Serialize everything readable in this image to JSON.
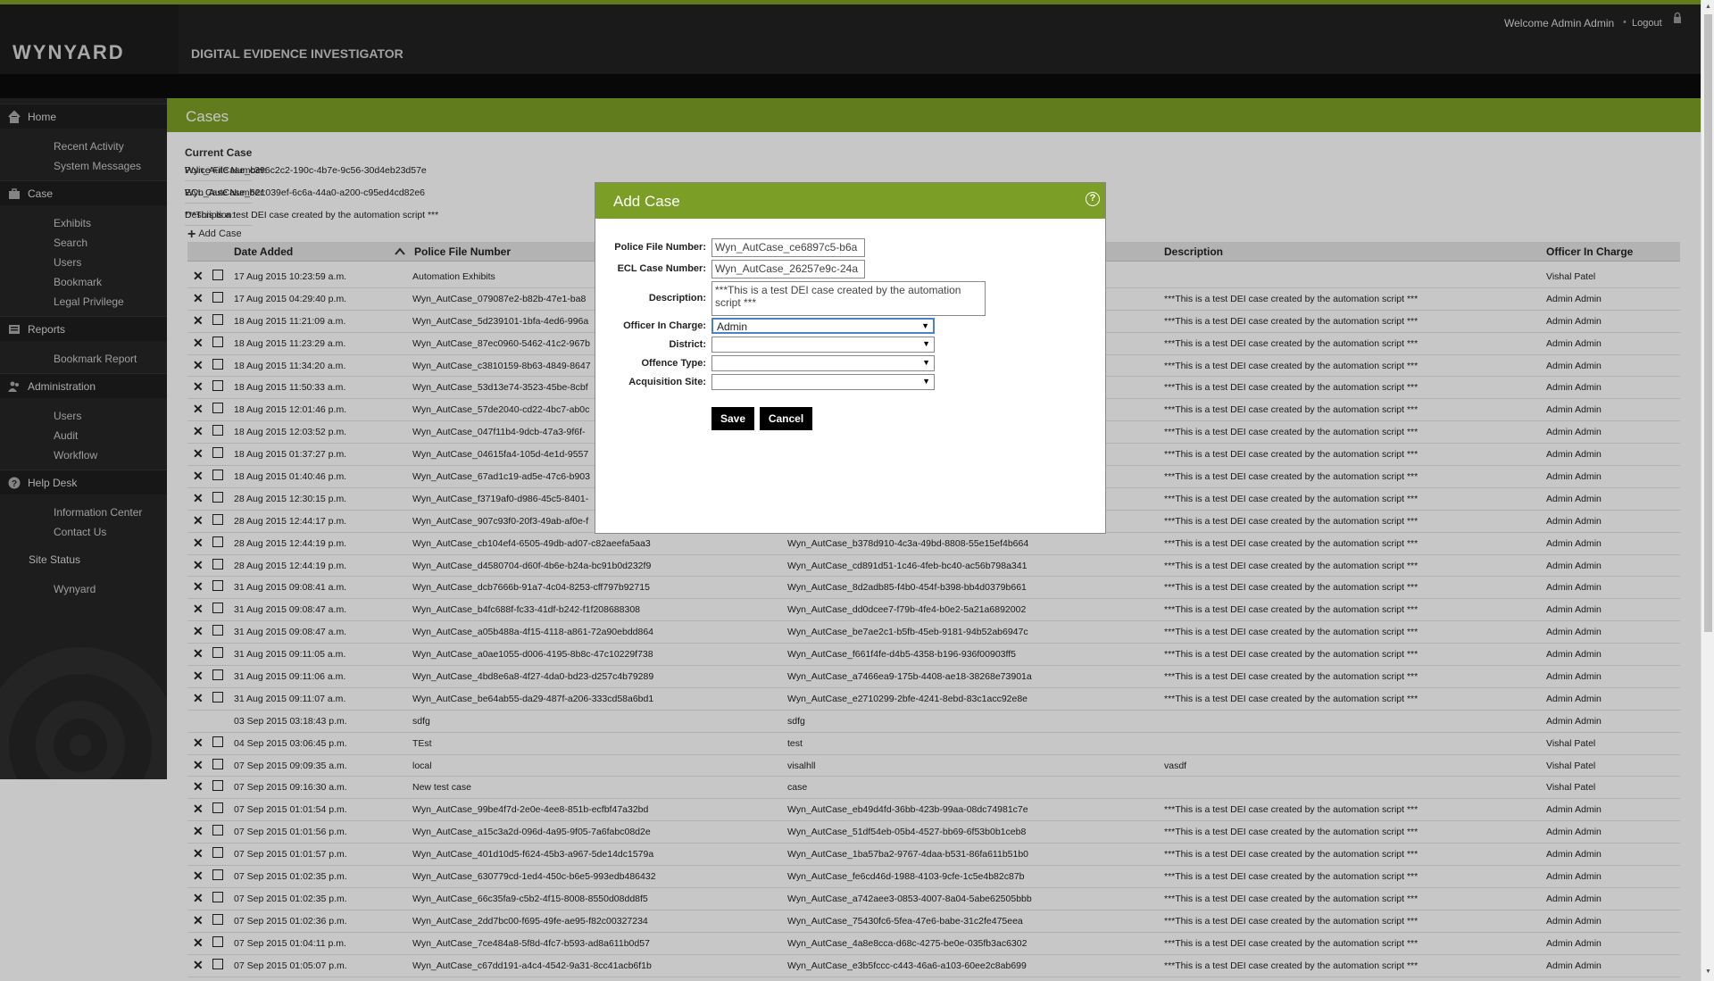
{
  "header": {
    "logo": "WYNYARD",
    "app_title": "DIGITAL EVIDENCE INVESTIGATOR",
    "welcome": "Welcome Admin Admin",
    "logout": "Logout"
  },
  "sidebar": {
    "home": "Home",
    "home_items": [
      "Recent Activity",
      "System Messages"
    ],
    "case": "Case",
    "case_items": [
      "Exhibits",
      "Search",
      "Users",
      "Bookmark",
      "Legal Privilege"
    ],
    "reports": "Reports",
    "reports_items": [
      "Bookmark Report"
    ],
    "administration": "Administration",
    "admin_items": [
      "Users",
      "Audit",
      "Workflow"
    ],
    "helpdesk": "Help Desk",
    "help_items": [
      "Information Center",
      "Contact Us"
    ],
    "site_status": "Site Status",
    "site": "Wynyard"
  },
  "page": {
    "title": "Cases",
    "current_case": {
      "heading": "Current Case",
      "police_label": "Police File Number:",
      "police_value": "Wyn_AutCase_c396c2c2-190c-4b7e-9c56-30d4eb23d57e",
      "ecl_label": "ECL Case Number:",
      "ecl_value": "Wyn_AutCase_621039ef-6c6a-44a0-a200-c95ed4cd82e6",
      "desc_label": "Description:",
      "desc_value": "***This is a test DEI case created by the automation script ***"
    },
    "add_case": "Add Case"
  },
  "table": {
    "headers": {
      "date": "Date Added",
      "police": "Police File Number",
      "desc": "Description",
      "officer": "Officer In Charge"
    },
    "rows": [
      {
        "date": "17 Aug 2015 10:23:59 a.m.",
        "pf": "Automation Exhibits",
        "ecl": "",
        "desc": "",
        "off": "Vishal Patel"
      },
      {
        "date": "17 Aug 2015 04:29:40 p.m.",
        "pf": "Wyn_AutCase_079087e2-b82b-47e1-ba8",
        "ecl": "",
        "desc": "***This is a test DEI case created by the automation script ***",
        "off": "Admin Admin"
      },
      {
        "date": "18 Aug 2015 11:21:09 a.m.",
        "pf": "Wyn_AutCase_5d239101-1bfa-4ed6-996a",
        "ecl": "",
        "desc": "***This is a test DEI case created by the automation script ***",
        "off": "Admin Admin"
      },
      {
        "date": "18 Aug 2015 11:23:29 a.m.",
        "pf": "Wyn_AutCase_87ec0960-5462-41c2-967b",
        "ecl": "",
        "desc": "***This is a test DEI case created by the automation script ***",
        "off": "Admin Admin"
      },
      {
        "date": "18 Aug 2015 11:34:20 a.m.",
        "pf": "Wyn_AutCase_c3810159-8b63-4849-8647",
        "ecl": "",
        "desc": "***This is a test DEI case created by the automation script ***",
        "off": "Admin Admin"
      },
      {
        "date": "18 Aug 2015 11:50:33 a.m.",
        "pf": "Wyn_AutCase_53d13e74-3523-45be-8cbf",
        "ecl": "",
        "desc": "***This is a test DEI case created by the automation script ***",
        "off": "Admin Admin"
      },
      {
        "date": "18 Aug 2015 12:01:46 p.m.",
        "pf": "Wyn_AutCase_57de2040-cd22-4bc7-ab0c",
        "ecl": "",
        "desc": "***This is a test DEI case created by the automation script ***",
        "off": "Admin Admin"
      },
      {
        "date": "18 Aug 2015 12:03:52 p.m.",
        "pf": "Wyn_AutCase_047f11b4-9dcb-47a3-9f6f-",
        "ecl": "",
        "desc": "***This is a test DEI case created by the automation script ***",
        "off": "Admin Admin"
      },
      {
        "date": "18 Aug 2015 01:37:27 p.m.",
        "pf": "Wyn_AutCase_04615fa4-105d-4e1d-9557",
        "ecl": "",
        "desc": "***This is a test DEI case created by the automation script ***",
        "off": "Admin Admin"
      },
      {
        "date": "18 Aug 2015 01:40:46 p.m.",
        "pf": "Wyn_AutCase_67ad1c19-ad5e-47c6-b903",
        "ecl": "",
        "desc": "***This is a test DEI case created by the automation script ***",
        "off": "Admin Admin"
      },
      {
        "date": "28 Aug 2015 12:30:15 p.m.",
        "pf": "Wyn_AutCase_f3719af0-d986-45c5-8401-",
        "ecl": "",
        "desc": "***This is a test DEI case created by the automation script ***",
        "off": "Admin Admin"
      },
      {
        "date": "28 Aug 2015 12:44:17 p.m.",
        "pf": "Wyn_AutCase_907c93f0-20f3-49ab-af0e-f",
        "ecl": "",
        "desc": "***This is a test DEI case created by the automation script ***",
        "off": "Admin Admin"
      },
      {
        "date": "28 Aug 2015 12:44:19 p.m.",
        "pf": "Wyn_AutCase_cb104ef4-6505-49db-ad07-c82aeefa5aa3",
        "ecl": "Wyn_AutCase_b378d910-4c3a-49bd-8808-55e15ef4b664",
        "desc": "***This is a test DEI case created by the automation script ***",
        "off": "Admin Admin"
      },
      {
        "date": "28 Aug 2015 12:44:19 p.m.",
        "pf": "Wyn_AutCase_d4580704-d60f-4b6e-b24a-bc91b0d232f9",
        "ecl": "Wyn_AutCase_cd891d51-1c46-4feb-bc40-ac56b798a341",
        "desc": "***This is a test DEI case created by the automation script ***",
        "off": "Admin Admin"
      },
      {
        "date": "31 Aug 2015 09:08:41 a.m.",
        "pf": "Wyn_AutCase_dcb7666b-91a7-4c04-8253-cff797b92715",
        "ecl": "Wyn_AutCase_8d2adb85-f4b0-454f-b398-bb4d0379b661",
        "desc": "***This is a test DEI case created by the automation script ***",
        "off": "Admin Admin"
      },
      {
        "date": "31 Aug 2015 09:08:47 a.m.",
        "pf": "Wyn_AutCase_b4fc688f-fc33-41df-b242-f1f208688308",
        "ecl": "Wyn_AutCase_dd0dcee7-f79b-4fe4-b0e2-5a21a6892002",
        "desc": "***This is a test DEI case created by the automation script ***",
        "off": "Admin Admin"
      },
      {
        "date": "31 Aug 2015 09:08:47 a.m.",
        "pf": "Wyn_AutCase_a05b488a-4f15-4118-a861-72a90ebdd864",
        "ecl": "Wyn_AutCase_be7ae2c1-b5fb-45eb-9181-94b52ab6947c",
        "desc": "***This is a test DEI case created by the automation script ***",
        "off": "Admin Admin"
      },
      {
        "date": "31 Aug 2015 09:11:05 a.m.",
        "pf": "Wyn_AutCase_a0ae1055-d006-4195-8b8c-47c10229f738",
        "ecl": "Wyn_AutCase_f661f4fe-d4b5-4358-b196-936f00903ff5",
        "desc": "***This is a test DEI case created by the automation script ***",
        "off": "Admin Admin"
      },
      {
        "date": "31 Aug 2015 09:11:06 a.m.",
        "pf": "Wyn_AutCase_4bd8e6a8-4f27-4da0-bd23-d257c4b79289",
        "ecl": "Wyn_AutCase_a7466ea9-175b-4408-ae18-38268e73901a",
        "desc": "***This is a test DEI case created by the automation script ***",
        "off": "Admin Admin"
      },
      {
        "date": "31 Aug 2015 09:11:07 a.m.",
        "pf": "Wyn_AutCase_be64ab55-da29-487f-a206-333cd58a6bd1",
        "ecl": "Wyn_AutCase_e2710299-2bfe-4241-8ebd-83c1acc92e8e",
        "desc": "***This is a test DEI case created by the automation script ***",
        "off": "Admin Admin"
      },
      {
        "date": "03 Sep 2015 03:18:43 p.m.",
        "pf": "sdfg",
        "ecl": "sdfg",
        "desc": "",
        "off": "Admin Admin",
        "noicons": true
      },
      {
        "date": "04 Sep 2015 03:06:45 p.m.",
        "pf": "TEst",
        "ecl": "test",
        "desc": "",
        "off": "Vishal Patel"
      },
      {
        "date": "07 Sep 2015 09:09:35 a.m.",
        "pf": "local",
        "ecl": "visalhll",
        "desc": "vasdf",
        "off": "Vishal Patel"
      },
      {
        "date": "07 Sep 2015 09:16:30 a.m.",
        "pf": "New test case",
        "ecl": "case",
        "desc": "",
        "off": "Vishal Patel"
      },
      {
        "date": "07 Sep 2015 01:01:54 p.m.",
        "pf": "Wyn_AutCase_99be4f7d-2e0e-4ee8-851b-ecfbf47a32bd",
        "ecl": "Wyn_AutCase_eb49d4fd-36bb-423b-99aa-08dc74981c7e",
        "desc": "***This is a test DEI case created by the automation script ***",
        "off": "Admin Admin"
      },
      {
        "date": "07 Sep 2015 01:01:56 p.m.",
        "pf": "Wyn_AutCase_a15c3a2d-096d-4a95-9f05-7a6fabc08d2e",
        "ecl": "Wyn_AutCase_51df54eb-05b4-4527-bb69-6f53b0b1ceb8",
        "desc": "***This is a test DEI case created by the automation script ***",
        "off": "Admin Admin"
      },
      {
        "date": "07 Sep 2015 01:01:57 p.m.",
        "pf": "Wyn_AutCase_401d10d5-f624-45b3-a967-5de14dc1579a",
        "ecl": "Wyn_AutCase_1ba57ba2-9767-4daa-b531-86fa611b51b0",
        "desc": "***This is a test DEI case created by the automation script ***",
        "off": "Admin Admin"
      },
      {
        "date": "07 Sep 2015 01:02:35 p.m.",
        "pf": "Wyn_AutCase_630779cd-1ed4-450c-b6e5-993edb486432",
        "ecl": "Wyn_AutCase_fe6cd46d-1988-4103-9cfe-1c5e4b82c87b",
        "desc": "***This is a test DEI case created by the automation script ***",
        "off": "Admin Admin"
      },
      {
        "date": "07 Sep 2015 01:02:35 p.m.",
        "pf": "Wyn_AutCase_66c35fa9-c5b2-4f15-8008-8550d08dd8f5",
        "ecl": "Wyn_AutCase_a742aee3-0853-4007-8a04-5abe62505bbb",
        "desc": "***This is a test DEI case created by the automation script ***",
        "off": "Admin Admin"
      },
      {
        "date": "07 Sep 2015 01:02:36 p.m.",
        "pf": "Wyn_AutCase_2dd7bc00-f695-49fe-ae95-f82c00327234",
        "ecl": "Wyn_AutCase_75430fc6-5fea-47e6-babe-31c2fe475eea",
        "desc": "***This is a test DEI case created by the automation script ***",
        "off": "Admin Admin"
      },
      {
        "date": "07 Sep 2015 01:04:11 p.m.",
        "pf": "Wyn_AutCase_7ce484a8-5f8d-4fc7-b593-ad8a611b0d57",
        "ecl": "Wyn_AutCase_4a8e8cca-d68c-4275-be0e-035fb3ac6302",
        "desc": "***This is a test DEI case created by the automation script ***",
        "off": "Admin Admin"
      },
      {
        "date": "07 Sep 2015 01:05:07 p.m.",
        "pf": "Wyn_AutCase_c67dd191-a4c4-4542-9a31-8cc41acb6f1b",
        "ecl": "Wyn_AutCase_e3b5fccc-c443-46a6-a103-60ee2c8ab699",
        "desc": "***This is a test DEI case created by the automation script ***",
        "off": "Admin Admin"
      }
    ]
  },
  "dialog": {
    "title": "Add Case",
    "help": "?",
    "police_label": "Police File Number:",
    "police_value": "Wyn_AutCase_ce6897c5-b6a",
    "ecl_label": "ECL Case Number:",
    "ecl_value": "Wyn_AutCase_26257e9c-24a",
    "desc_label": "Description:",
    "desc_value": "***This is a test DEI case created by the automation script ***",
    "officer_label": "Officer In Charge:",
    "officer_value": "Admin",
    "district_label": "District:",
    "district_value": "",
    "offence_label": "Offence Type:",
    "offence_value": "",
    "site_label": "Acquisition Site:",
    "site_value": "",
    "save": "Save",
    "cancel": "Cancel"
  }
}
